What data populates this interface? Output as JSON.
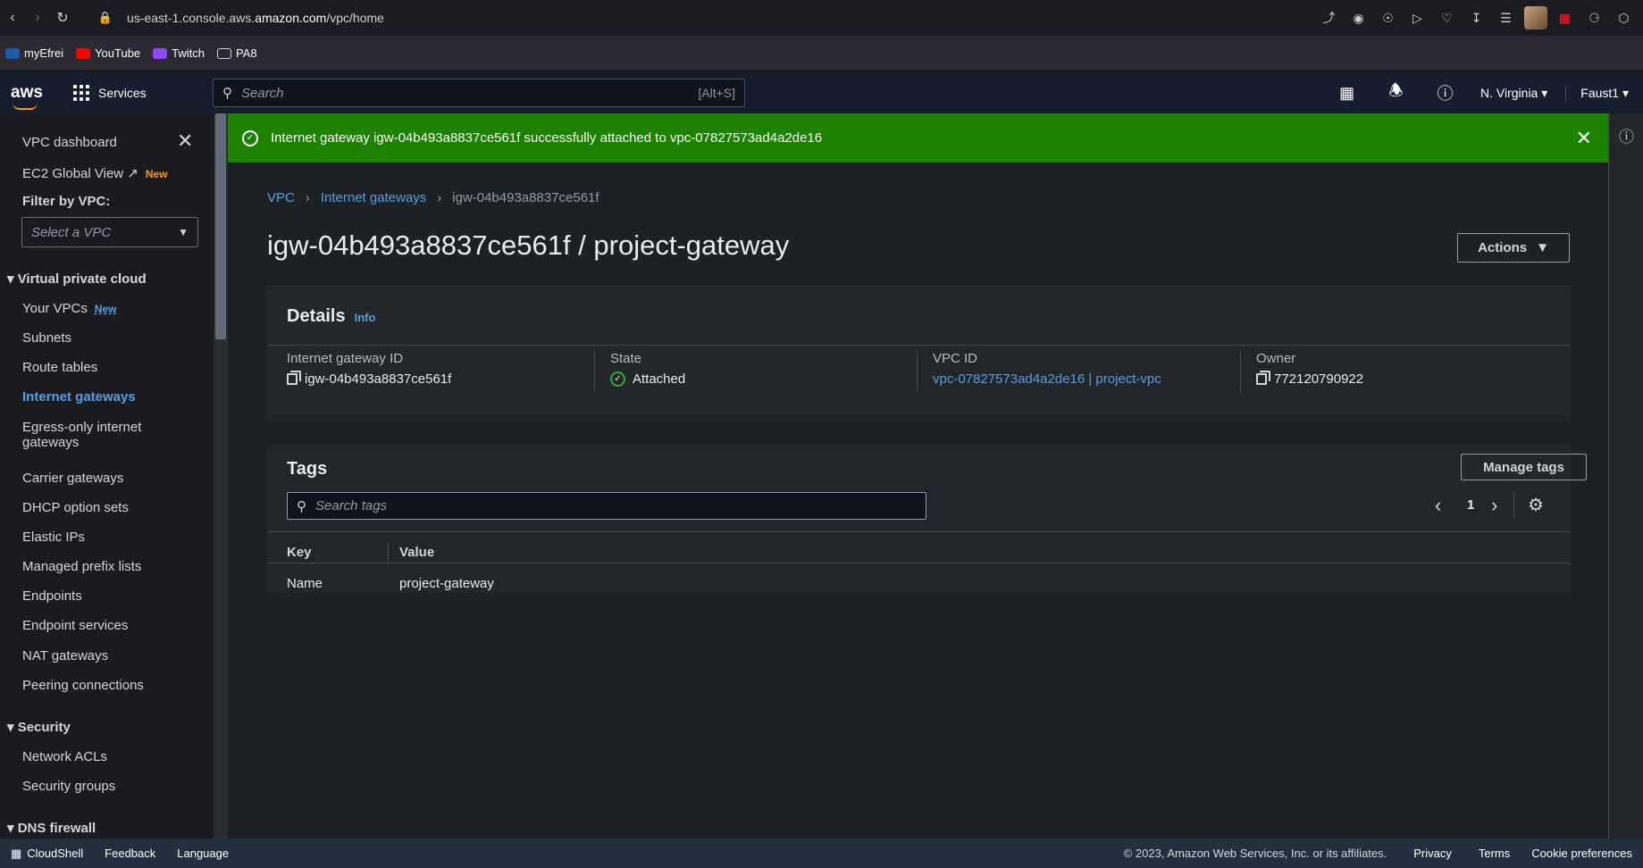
{
  "browser": {
    "url_prefix": "us-east-1.console.aws.",
    "url_domain": "amazon.com",
    "url_path": "/vpc/home"
  },
  "bookmarks": [
    {
      "label": "myEfrei",
      "color": "#1e5aa8"
    },
    {
      "label": "YouTube",
      "color": "#ff0000"
    },
    {
      "label": "Twitch",
      "color": "#9146ff"
    },
    {
      "label": "PA8",
      "color": "#cfcfd8"
    }
  ],
  "awsnav": {
    "logo": "aws",
    "services": "Services",
    "search_placeholder": "Search",
    "search_shortcut": "[Alt+S]",
    "region": "N. Virginia",
    "user": "Faust1"
  },
  "sidebar": {
    "dashboard": "VPC dashboard",
    "global_view": "EC2 Global View",
    "global_view_badge": "New",
    "filter_label": "Filter by VPC:",
    "filter_placeholder": "Select a VPC",
    "section_vpc": "Virtual private cloud",
    "your_vpcs": "Your VPCs",
    "your_vpcs_badge": "New",
    "subnets": "Subnets",
    "route_tables": "Route tables",
    "internet_gateways": "Internet gateways",
    "egress_line1": "Egress-only internet",
    "egress_line2": "gateways",
    "carrier_gateways": "Carrier gateways",
    "dhcp": "DHCP option sets",
    "elastic_ips": "Elastic IPs",
    "prefix_lists": "Managed prefix lists",
    "endpoints": "Endpoints",
    "endpoint_services": "Endpoint services",
    "nat_gateways": "NAT gateways",
    "peering": "Peering connections",
    "section_security": "Security",
    "network_acls": "Network ACLs",
    "security_groups": "Security groups",
    "section_dns": "DNS firewall"
  },
  "flash": {
    "message": "Internet gateway igw-04b493a8837ce561f successfully attached to vpc-07827573ad4a2de16"
  },
  "breadcrumb": {
    "root": "VPC",
    "parent": "Internet gateways",
    "current": "igw-04b493a8837ce561f"
  },
  "page": {
    "title": "igw-04b493a8837ce561f / project-gateway",
    "actions": "Actions"
  },
  "details": {
    "heading": "Details",
    "info": "Info",
    "igw_label": "Internet gateway ID",
    "igw_value": "igw-04b493a8837ce561f",
    "state_label": "State",
    "state_value": "Attached",
    "vpc_label": "VPC ID",
    "vpc_value": "vpc-07827573ad4a2de16 | project-vpc",
    "owner_label": "Owner",
    "owner_value": "772120790922"
  },
  "tags": {
    "heading": "Tags",
    "manage": "Manage tags",
    "search_placeholder": "Search tags",
    "page": "1",
    "columns": [
      "Key",
      "Value"
    ],
    "rows": [
      {
        "key": "Name",
        "value": "project-gateway"
      }
    ]
  },
  "footer": {
    "cloudshell": "CloudShell",
    "feedback": "Feedback",
    "language": "Language",
    "copyright": "© 2023, Amazon Web Services, Inc. or its affiliates.",
    "privacy": "Privacy",
    "terms": "Terms",
    "cookies": "Cookie preferences"
  }
}
